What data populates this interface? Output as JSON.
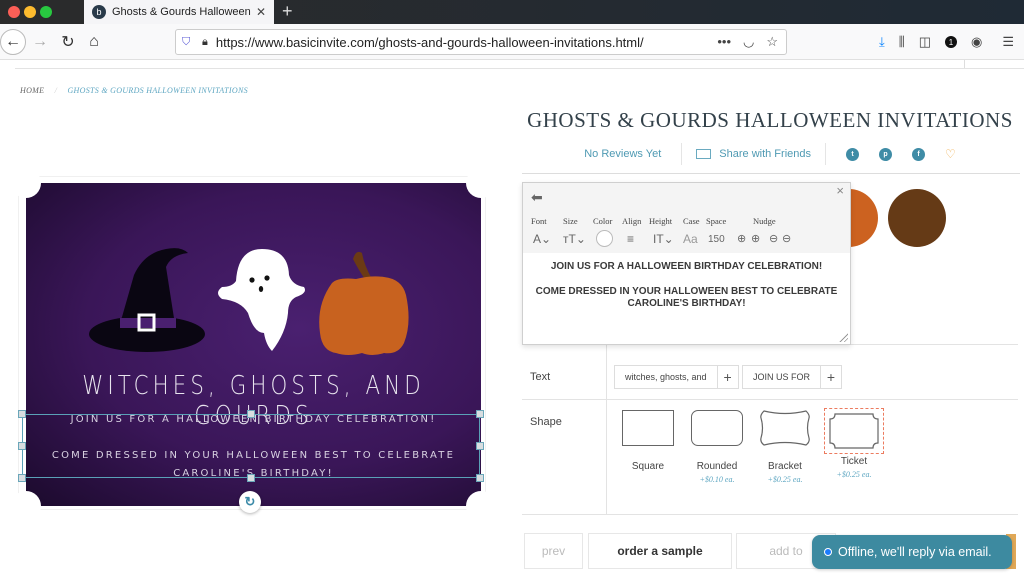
{
  "browser": {
    "tab_title": "Ghosts & Gourds Halloween Inv",
    "tab_favicon": "b",
    "url": "https://www.basicinvite.com/ghosts-and-gourds-halloween-invitations.html/",
    "url_more": "•••",
    "toolbar_badge": "1"
  },
  "breadcrumb": {
    "home": "HOME",
    "separator": "/",
    "current": "GHOSTS & GOURDS HALLOWEEN INVITATIONS"
  },
  "card": {
    "title": "WITCHES, GHOSTS, AND GOURDS",
    "line1": "JOIN US FOR A HALLOWEEN BIRTHDAY CELEBRATION!",
    "line2": "COME DRESSED IN YOUR HALLOWEEN BEST TO CELEBRATE",
    "line3": "CAROLINE'S BIRTHDAY!",
    "colors": {
      "background": "#3a1658",
      "hat": "#0a0612",
      "pumpkin": "#c8621f",
      "stem": "#6b3a14"
    }
  },
  "product": {
    "title": "GHOSTS & GOURDS HALLOWEEN INVITATIONS",
    "reviews": "No Reviews Yet",
    "share": "Share with Friends",
    "social": [
      "twitter",
      "pinterest",
      "facebook",
      "favorite"
    ]
  },
  "editor": {
    "tools": [
      {
        "label": "Font",
        "control": "A⌄"
      },
      {
        "label": "Size",
        "control": "ᴛT⌄"
      },
      {
        "label": "Color",
        "control": ""
      },
      {
        "label": "Align",
        "control": "≡"
      },
      {
        "label": "Height",
        "control": "IT⌄"
      },
      {
        "label": "Case",
        "control": "Aa"
      },
      {
        "label": "Space",
        "control": "150"
      },
      {
        "label": "Nudge",
        "control": ""
      }
    ],
    "text_line1": "JOIN US FOR A HALLOWEEN BIRTHDAY CELEBRATION!",
    "text_line2": "COME DRESSED IN YOUR HALLOWEEN BEST TO CELEBRATE",
    "text_line3": "CAROLINE'S BIRTHDAY!"
  },
  "swatches": [
    {
      "name": "orange",
      "color": "#cc6220"
    },
    {
      "name": "brown",
      "color": "#653a16"
    }
  ],
  "options": {
    "text_label": "Text",
    "text_chips": [
      "witches, ghosts, and",
      "JOIN US FOR"
    ],
    "add_symbol": "+",
    "shape_label": "Shape",
    "shapes": [
      {
        "name": "Square",
        "price": ""
      },
      {
        "name": "Rounded",
        "price": "+$0.10 ea."
      },
      {
        "name": "Bracket",
        "price": "+$0.25 ea."
      },
      {
        "name": "Ticket",
        "price": "+$0.25 ea.",
        "selected": true
      }
    ]
  },
  "actions": {
    "prev": "prev",
    "order_sample": "order a sample",
    "add_to": "add to"
  },
  "chat": {
    "status": "Offline, we'll reply via email."
  }
}
